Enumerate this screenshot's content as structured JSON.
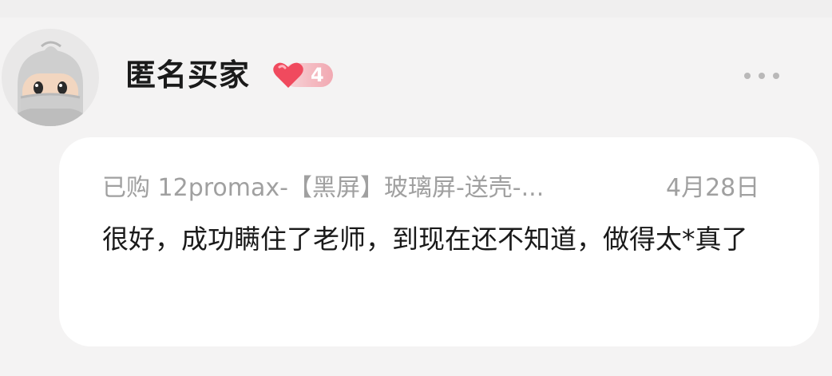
{
  "review": {
    "user": {
      "name": "匿名买家",
      "level": "4",
      "avatar_icon": "anonymous-ninja-avatar",
      "badge_icon": "heart-icon",
      "badge_color": "#f04a5e"
    },
    "more_icon": "more-dots-icon",
    "purchase": {
      "label": "已购 12promax-【黑屏】玻璃屏-送壳-...",
      "date": "4月28日"
    },
    "text": "很好，成功瞒住了老师，到现在还不知道，做得太*真了"
  },
  "colors": {
    "background": "#f4f3f3",
    "card": "#ffffff",
    "primary_text": "#1a1a1a",
    "secondary_text": "#a0a0a0"
  }
}
